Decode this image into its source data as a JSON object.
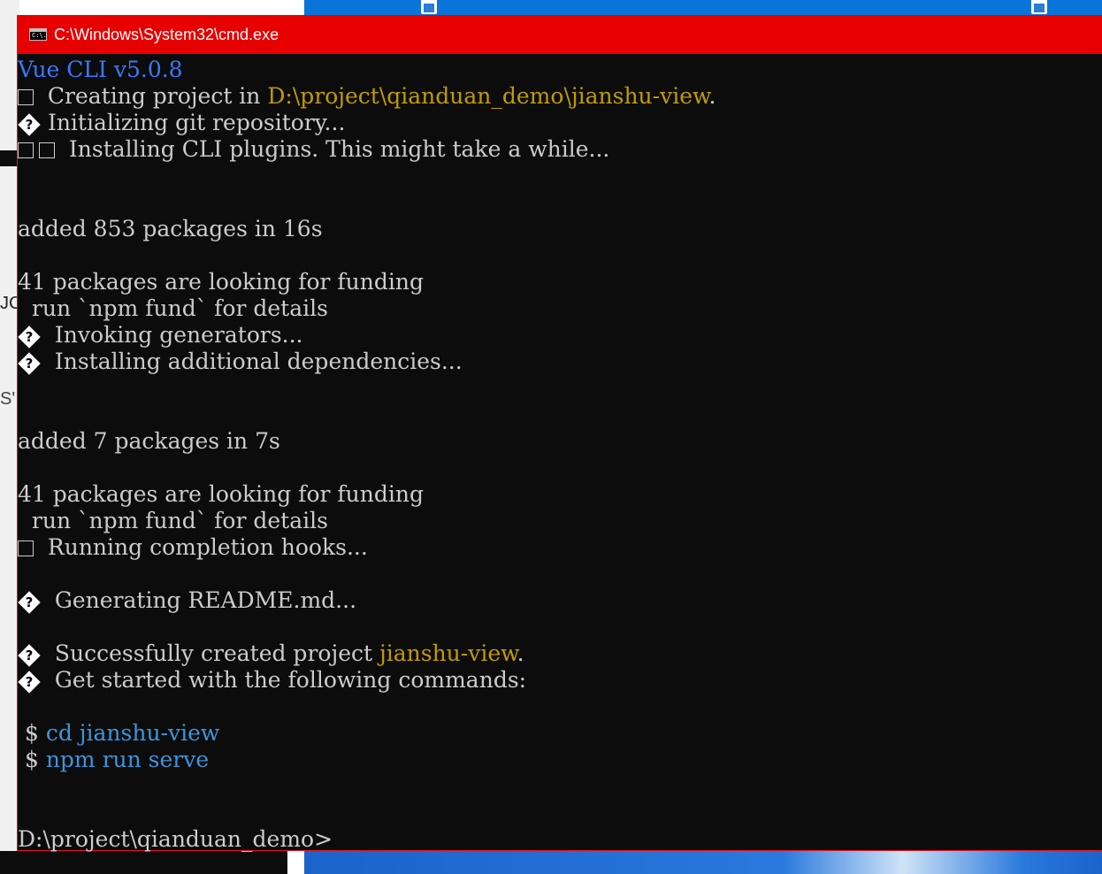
{
  "window": {
    "title": "C:\\Windows\\System32\\cmd.exe",
    "icon_label": "C:\\."
  },
  "background": {
    "left_text_1": "JC",
    "left_text_2": "S'"
  },
  "console": {
    "vue_cli": "Vue CLI v5.0.8",
    "creating_prefix": "  Creating project in ",
    "creating_path": "D:\\project\\qianduan_demo\\jianshu-view",
    "creating_suffix": ".",
    "init_git": " Initializing git repository...",
    "installing_plugins": "  Installing CLI plugins. This might take a while...",
    "added_853": "added 853 packages in 16s",
    "funding_1": "41 packages are looking for funding",
    "npm_fund_1": "  run `npm fund` for details",
    "invoking": "  Invoking generators...",
    "installing_deps": "  Installing additional dependencies...",
    "added_7": "added 7 packages in 7s",
    "funding_2": "41 packages are looking for funding",
    "npm_fund_2": "  run `npm fund` for details",
    "completion_hooks": "  Running completion hooks...",
    "readme": "  Generating README.md...",
    "success_prefix": "  Successfully created project ",
    "success_name": "jianshu-view",
    "success_suffix": ".",
    "get_started": "  Get started with the following commands:",
    "dollar": " $ ",
    "cmd_cd": "cd jianshu-view",
    "cmd_serve": "npm run serve",
    "prompt": "D:\\project\\qianduan_demo>",
    "unknown_glyph": "?"
  },
  "colors": {
    "titlebar": "#e60000",
    "console_bg": "#0c0c0c",
    "console_text": "#cccccc",
    "vue_blue": "#3b78ff",
    "path_yellow": "#c19c00",
    "command_cyan": "#3a96dd"
  }
}
